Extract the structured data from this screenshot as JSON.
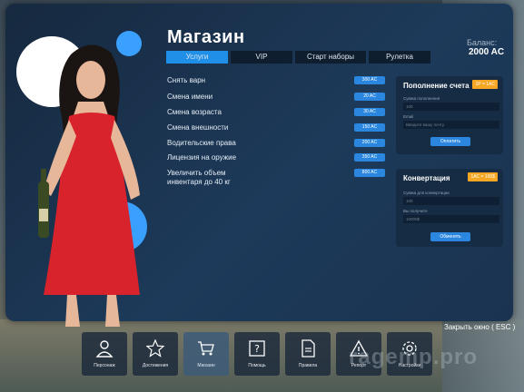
{
  "page": {
    "title": "Магазин",
    "balance_label": "Баланс:",
    "balance_value": "2000 AC",
    "close_text": "Закрыть окно ( ESC )",
    "watermark": "ragemp.pro"
  },
  "tabs": [
    {
      "label": "Услуги",
      "active": true
    },
    {
      "label": "VIP",
      "active": false
    },
    {
      "label": "Старт наборы",
      "active": false
    },
    {
      "label": "Рулетка",
      "active": false
    }
  ],
  "services": [
    {
      "label": "Снять варн",
      "price": "300 AC"
    },
    {
      "label": "Смена имени",
      "price": "20 AC"
    },
    {
      "label": "Смена возраста",
      "price": "30 AC"
    },
    {
      "label": "Смена внешности",
      "price": "150 AC"
    },
    {
      "label": "Водительские права",
      "price": "200 AC"
    },
    {
      "label": "Лицензия на оружие",
      "price": "350 AC"
    },
    {
      "label": "Увеличить объем инвентаря до 40 кг",
      "price": "800 AC"
    }
  ],
  "topup": {
    "title": "Пополнение счета",
    "badge": "1Р = 1AC",
    "amount_label": "Сумма пополнения",
    "amount_placeholder": "100",
    "email_label": "Email",
    "email_placeholder": "Введите вашу почту",
    "button": "Оплатить"
  },
  "convert": {
    "title": "Конвертация",
    "badge": "1AC = 100$",
    "amount_label": "Сумма для конвертации",
    "amount_placeholder": "100",
    "result_label": "Вы получите",
    "result_value": "10000$",
    "button": "Обменять"
  },
  "dock": [
    {
      "label": "Персонаж",
      "icon": "user-icon",
      "active": false
    },
    {
      "label": "Достижения",
      "icon": "star-icon",
      "active": false
    },
    {
      "label": "Магазин",
      "icon": "cart-icon",
      "active": true
    },
    {
      "label": "Помощь",
      "icon": "help-icon",
      "active": false
    },
    {
      "label": "Правила",
      "icon": "document-icon",
      "active": false
    },
    {
      "label": "Репорт",
      "icon": "warning-icon",
      "active": false
    },
    {
      "label": "Настройки",
      "icon": "gear-icon",
      "active": false
    }
  ]
}
